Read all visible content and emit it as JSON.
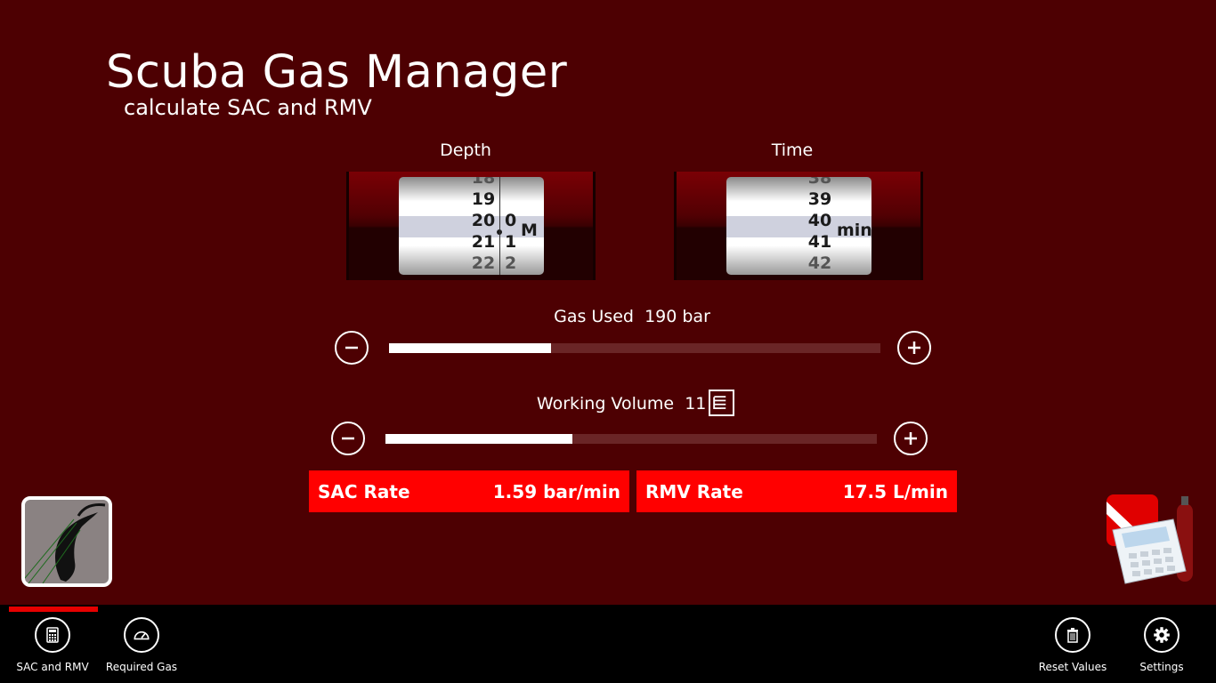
{
  "app": {
    "title": "Scuba Gas Manager",
    "subtitle": "calculate SAC and RMV"
  },
  "depth": {
    "label": "Depth",
    "major_values": [
      "18",
      "19",
      "20",
      "21",
      "22"
    ],
    "minor_values": [
      "0",
      "1",
      "2"
    ],
    "unit": "M"
  },
  "time": {
    "label": "Time",
    "values": [
      "38",
      "39",
      "40",
      "41",
      "42"
    ],
    "unit": "min"
  },
  "gas_used": {
    "label": "Gas Used",
    "value": "190 bar",
    "slider_fraction": 0.33
  },
  "working_volume": {
    "label": "Working Volume",
    "value": "11 L",
    "slider_fraction": 0.38
  },
  "results": {
    "sac_label": "SAC Rate",
    "sac_value": "1.59 bar/min",
    "rmv_label": "RMV Rate",
    "rmv_value": "17.5 L/min"
  },
  "appbar": {
    "sac_rmv": "SAC and RMV",
    "required_gas": "Required Gas",
    "reset": "Reset Values",
    "settings": "Settings"
  },
  "colors": {
    "background": "#4d0002",
    "accent": "#ff0000",
    "appbar": "#000000"
  }
}
